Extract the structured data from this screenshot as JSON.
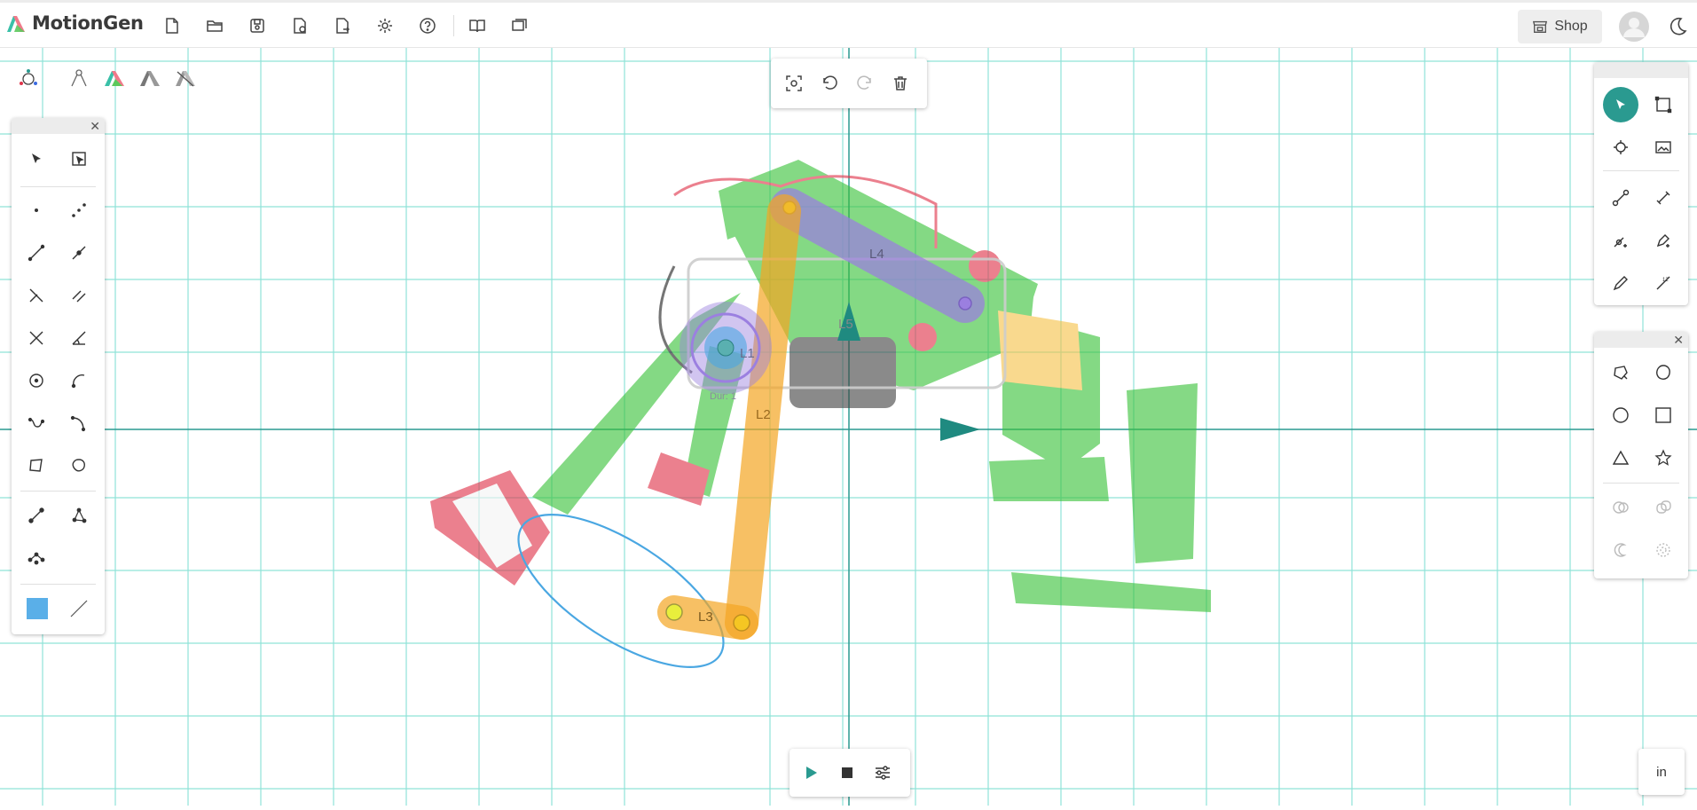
{
  "app": {
    "title": "MotionGen"
  },
  "toolbar": {
    "icons": [
      "new-file-icon",
      "open-folder-icon",
      "save-icon",
      "save-as-icon",
      "export-icon",
      "settings-icon",
      "help-icon",
      "tutorial-book-icon",
      "gallery-icon"
    ],
    "shop_label": "Shop"
  },
  "history_toolbar": {
    "icons": [
      "fit-view-icon",
      "undo-icon",
      "redo-icon",
      "delete-icon"
    ]
  },
  "left_panel": {
    "tools": [
      "select-arrow-icon",
      "select-box-icon",
      "point-icon",
      "multipoint-icon",
      "line-icon",
      "line-through-point-icon",
      "perpendicular-icon",
      "parallel-icon",
      "intersect-icon",
      "angle-icon",
      "circle-icon",
      "arc-icon",
      "curve-icon",
      "spline-icon",
      "polygon-icon",
      "closed-curve-icon",
      "link-dyad-icon",
      "link-triad-icon",
      "chain-icon"
    ],
    "fill_color": "#5aafe8"
  },
  "right_panel": {
    "tools": [
      "select-arrow-icon",
      "select-box-icon",
      "edit-image-icon",
      "insert-image-icon",
      "link-icon",
      "link-slider-icon",
      "add-joint-icon",
      "add-pen-icon",
      "pen-icon",
      "measure-icon"
    ]
  },
  "shape_panel": {
    "tools": [
      "pentagon-icon",
      "blob-icon",
      "circle-shape-icon",
      "square-shape-icon",
      "triangle-shape-icon",
      "star-shape-icon",
      "boolean-union-icon",
      "boolean-subtract-icon",
      "boolean-intersect-icon",
      "boolean-exclude-icon"
    ]
  },
  "mechanism": {
    "links": [
      {
        "label": "L1",
        "color": "#9b7fe0"
      },
      {
        "label": "L2",
        "color": "#f5a623"
      },
      {
        "label": "L3",
        "color": "#f5a623"
      },
      {
        "label": "L4",
        "color": "#9b7fe0"
      },
      {
        "label": "L5",
        "color": "#999999"
      }
    ],
    "driver_label": "Dur: 1",
    "accent": "#2a9a90",
    "grid_color": "#7fded2"
  },
  "playback": {
    "icons": [
      "play-icon",
      "stop-icon",
      "animation-settings-icon"
    ]
  },
  "units": {
    "label": "in"
  }
}
